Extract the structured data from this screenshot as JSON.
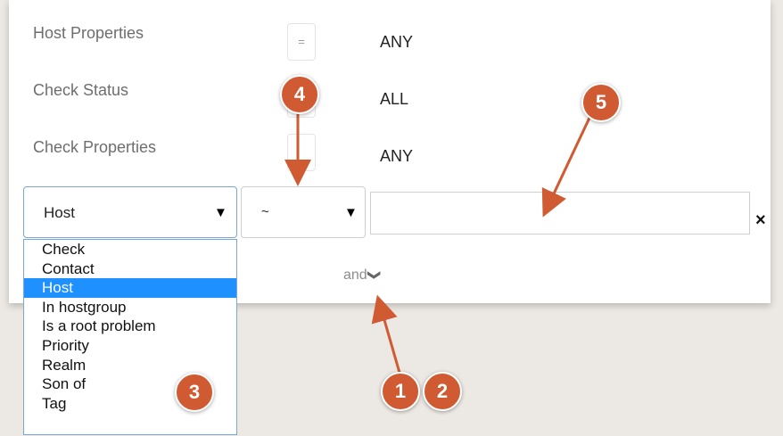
{
  "properties": [
    {
      "label": "Host Properties",
      "operator": "=",
      "value": "ANY"
    },
    {
      "label": "Check Status",
      "operator": "",
      "value": "ALL"
    },
    {
      "label": "Check Properties",
      "operator": "",
      "value": "ANY"
    }
  ],
  "filter": {
    "field_select": "Host",
    "operator_select": "~",
    "value_input": "",
    "remove_label": "×",
    "dropdown_options": [
      "Check",
      "Contact",
      "Host",
      "In hostgroup",
      "Is a root problem",
      "Priority",
      "Realm",
      "Son of",
      "Tag"
    ],
    "selected_option": "Host"
  },
  "conjunction": {
    "label": "and",
    "chevron": "❯"
  },
  "badges": [
    "1",
    "2",
    "3",
    "4",
    "5"
  ],
  "colors": {
    "badge": "#d05a32",
    "arrow": "#d05a32",
    "selected": "#1e90ff"
  }
}
